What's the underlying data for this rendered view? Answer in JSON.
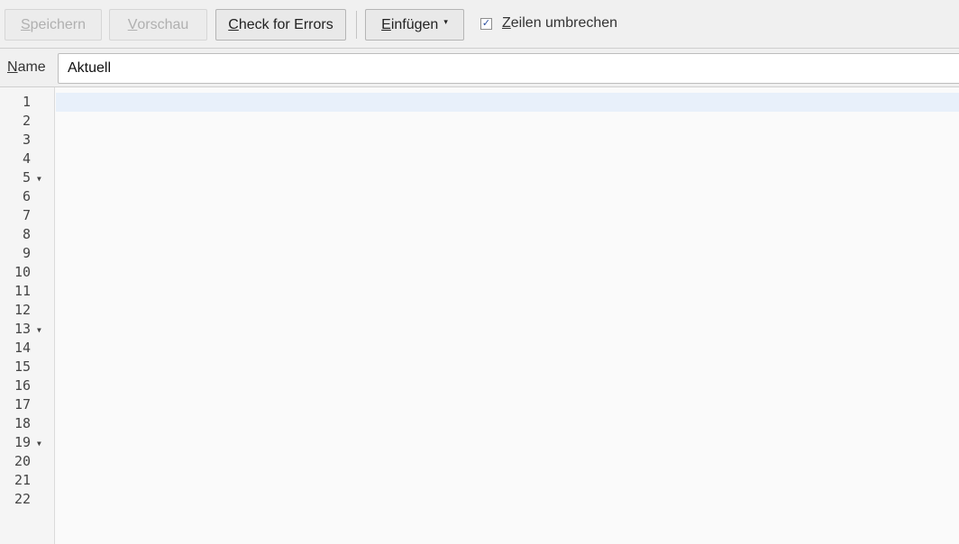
{
  "toolbar": {
    "save_label": "Speichern",
    "save_accesskey": "S",
    "save_rest": "peichern",
    "preview_accesskey": "V",
    "preview_rest": "orschau",
    "check_accesskey": "C",
    "check_rest": "heck for Errors",
    "insert_accesskey": "E",
    "insert_rest": "infügen",
    "insert_caret": "▾",
    "wrap_checked": true,
    "wrap_check_glyph": "✓",
    "wrap_accesskey": "Z",
    "wrap_rest": "eilen umbrechen"
  },
  "namebar": {
    "label_accesskey": "N",
    "label_rest": "ame",
    "value": "Aktuell"
  },
  "editor": {
    "lines": [
      "1",
      "2",
      "3",
      "4",
      "5",
      "6",
      "7",
      "8",
      "9",
      "10",
      "11",
      "12",
      "13",
      "14",
      "15",
      "16",
      "17",
      "18",
      "19",
      "20",
      "21",
      "22"
    ],
    "fold_lines": [
      "5",
      "13",
      "19"
    ],
    "fold_glyph": "▼",
    "active_line": 1
  },
  "colors": {
    "active_line": "#e8f0fa",
    "disabled_text": "#b0b0b0"
  }
}
